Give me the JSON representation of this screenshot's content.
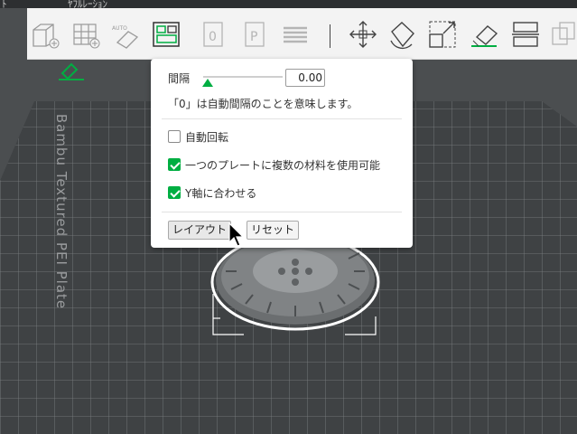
{
  "top_menu": {
    "items": [
      "ﾄ",
      "ﾔﾌﾙﾚｰｼｮﾝ"
    ]
  },
  "toolbar": {
    "buttons": [
      "add-cube",
      "grid-plus",
      "auto-orient",
      "arrange",
      "split-objects",
      "split-parts",
      "layers",
      "move",
      "rotate",
      "scale",
      "lay-on-face",
      "cut",
      "boolean"
    ],
    "active": "arrange"
  },
  "plate": {
    "label": "Bambu Textured PEI Plate"
  },
  "arrange_panel": {
    "spacing_label": "間隔",
    "spacing_value": "0.00",
    "spacing_fraction": 0.0,
    "hint": "「0」は自動間隔のことを意味します。",
    "options": [
      {
        "label": "自動回転",
        "checked": false
      },
      {
        "label": "一つのプレートに複数の材料を使用可能",
        "checked": true
      },
      {
        "label": "Y軸に合わせる",
        "checked": true
      }
    ],
    "arrange_button": "レイアウト",
    "reset_button": "リセット"
  },
  "colors": {
    "accent": "#00ae42",
    "toolbar_bg": "#f3f3f3",
    "bed": "#3e4143"
  }
}
